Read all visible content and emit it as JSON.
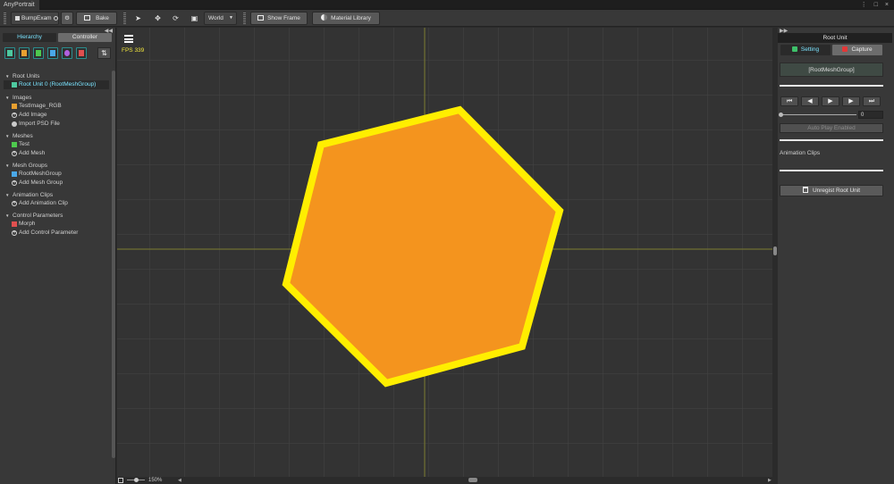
{
  "window": {
    "tab_title": "AnyPortrait",
    "controls": "⋮ □ ×"
  },
  "toolbar": {
    "project_name": "BumpExam",
    "bake_label": "Bake",
    "space_value": "World",
    "show_frame_label": "Show Frame",
    "material_library_label": "Material Library"
  },
  "left_panel": {
    "tabs": [
      "Hierarchy",
      "Controller"
    ],
    "active_tab": "Hierarchy",
    "sections": [
      {
        "title": "Root Units",
        "items": [
          {
            "label": "Root Unit 0 (RootMeshGroup)",
            "selected": true,
            "icon": "root-unit-icon"
          }
        ]
      },
      {
        "title": "Images",
        "items": [
          {
            "label": "TestImage_RGB",
            "icon": "image-icon"
          },
          {
            "label": "Add Image",
            "icon": "add-icon"
          },
          {
            "label": "Import PSD File",
            "icon": "psd-icon"
          }
        ]
      },
      {
        "title": "Meshes",
        "items": [
          {
            "label": "Test",
            "icon": "mesh-icon"
          },
          {
            "label": "Add Mesh",
            "icon": "add-icon"
          }
        ]
      },
      {
        "title": "Mesh Groups",
        "items": [
          {
            "label": "RootMeshGroup",
            "icon": "mesh-group-icon"
          },
          {
            "label": "Add Mesh Group",
            "icon": "add-icon"
          }
        ]
      },
      {
        "title": "Animation Clips",
        "items": [
          {
            "label": "Add Animation Clip",
            "icon": "add-icon"
          }
        ]
      },
      {
        "title": "Control Parameters",
        "items": [
          {
            "label": "Morph",
            "icon": "control-param-icon"
          },
          {
            "label": "Add Control Parameter",
            "icon": "add-icon"
          }
        ]
      }
    ]
  },
  "canvas": {
    "fps_text": "FPS 339",
    "zoom_text": "150%",
    "background": "#333333",
    "hexagon_fill": "#f4941e",
    "hexagon_outline": "#ffee00"
  },
  "right_panel": {
    "title": "Root Unit",
    "tabs": [
      "Setting",
      "Capture"
    ],
    "active_tab": "Setting",
    "root_mesh_group": "[RootMeshGroup]",
    "time_value": "0",
    "auto_play_label": "Auto Play Enabled",
    "animation_clips_label": "Animation Clips",
    "unregist_label": "Unregist Root Unit"
  },
  "colors": {
    "accent": "#7be4ff",
    "panel": "#383838"
  }
}
